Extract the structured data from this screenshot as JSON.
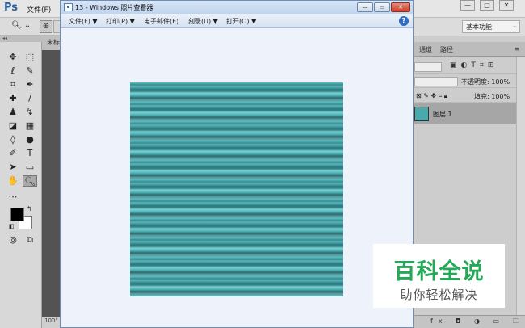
{
  "photoshop": {
    "logo": "Ps",
    "menu": {
      "file": "文件(F)"
    },
    "doc_tab": "未标",
    "status_zoom": "100°",
    "workspace": "基本功能",
    "panels": {
      "tabs": [
        "通道",
        "路径"
      ],
      "opacity_label": "不透明度: 100%",
      "fill_label": "填充: 100%",
      "layer_name": "图层 1",
      "bottom_icons": "fx ◘ ◑ ▭ 🗀 🗑"
    }
  },
  "viewer": {
    "title": "13 - Windows 照片查看器",
    "menu": [
      {
        "label": "文件(F)",
        "caret": "▼"
      },
      {
        "label": "打印(P)",
        "caret": "▼"
      },
      {
        "label": "电子邮件(E)",
        "caret": ""
      },
      {
        "label": "刻录(U)",
        "caret": "▼"
      },
      {
        "label": "打开(O)",
        "caret": "▼"
      }
    ],
    "help": "?"
  },
  "watermark": {
    "title": "百科全说",
    "subtitle": "助你轻松解决"
  }
}
